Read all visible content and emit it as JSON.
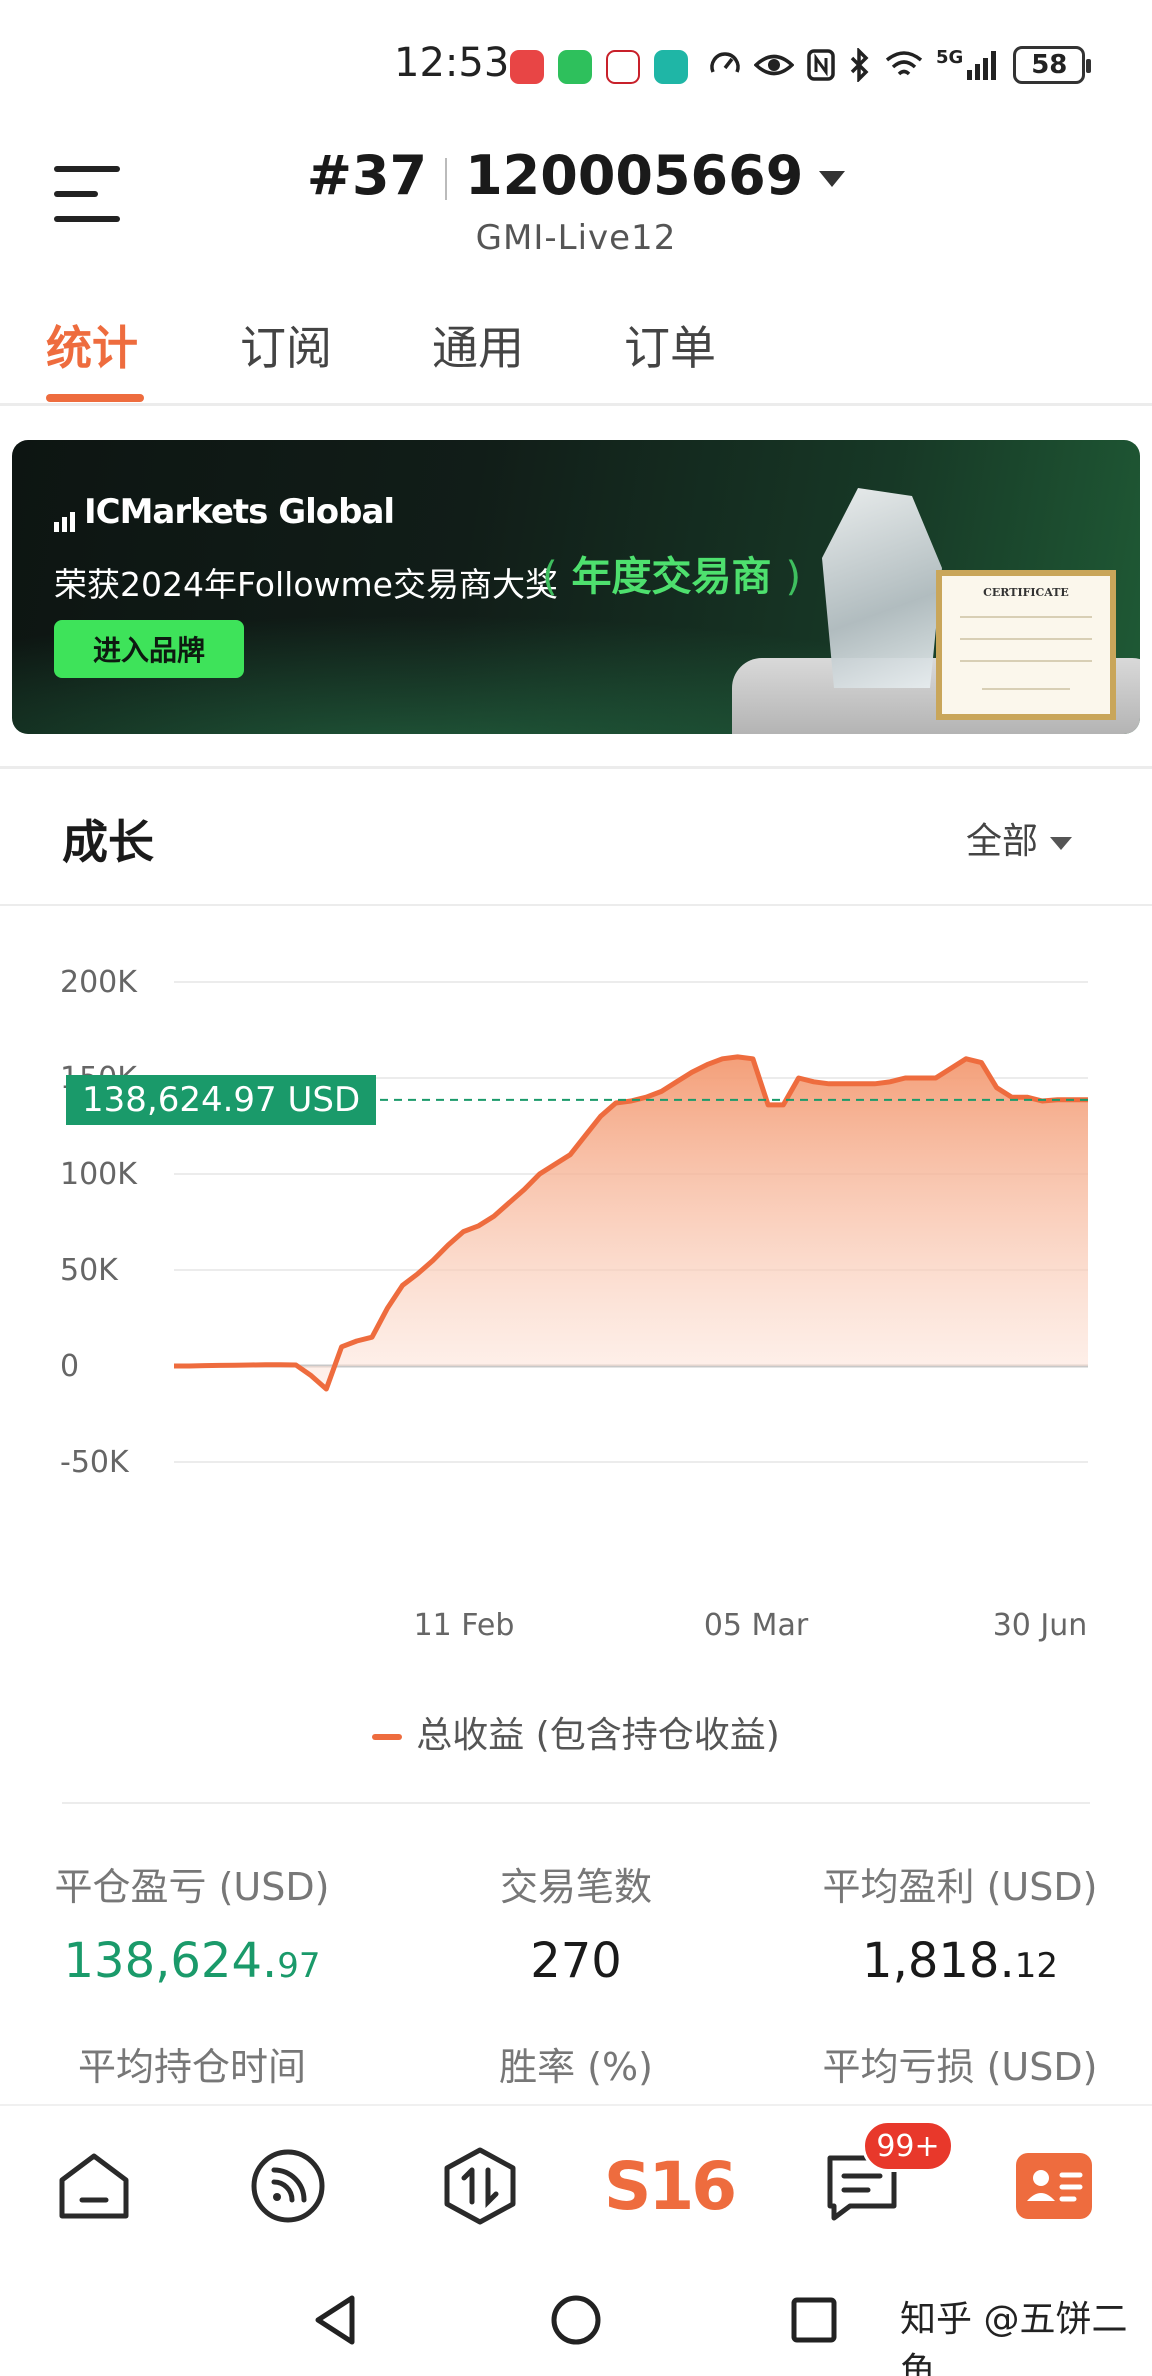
{
  "status_bar": {
    "time": "12:53",
    "network": "5G",
    "battery": "58"
  },
  "header": {
    "account_rank": "#37",
    "account_number": "120005669",
    "server": "GMI-Live12"
  },
  "tabs": [
    {
      "label": "统计",
      "active": true
    },
    {
      "label": "订阅",
      "active": false
    },
    {
      "label": "通用",
      "active": false
    },
    {
      "label": "订单",
      "active": false
    }
  ],
  "banner": {
    "brand": "ICMarkets Global",
    "text": "荣获2024年Followme交易商大奖",
    "award": "年度交易商",
    "button": "进入品牌",
    "certificate_title": "CERTIFICATE"
  },
  "growth": {
    "title": "成长",
    "filter": "全部"
  },
  "chart_data": {
    "type": "area",
    "y_ticks": [
      "200K",
      "150K",
      "100K",
      "50K",
      "0",
      "-50K"
    ],
    "ylim": [
      -50000,
      200000
    ],
    "x_ticks": [
      "11 Feb",
      "05 Mar",
      "30 Jun"
    ],
    "last_value_label": "138,624.97 USD",
    "last_value": 138624.97,
    "series": [
      {
        "name": "总收益 (包含持仓收益)",
        "color": "#ee6c3e",
        "values": [
          0,
          0,
          200,
          300,
          400,
          500,
          600,
          700,
          500,
          -5000,
          -12000,
          10000,
          13000,
          15000,
          30000,
          42000,
          48000,
          55000,
          63000,
          70000,
          73000,
          78000,
          85000,
          92000,
          100000,
          105000,
          110000,
          120000,
          130000,
          137000,
          138000,
          140000,
          143000,
          148000,
          153000,
          157000,
          160000,
          161000,
          160000,
          136000,
          136000,
          150000,
          148000,
          147000,
          147000,
          147000,
          147000,
          148000,
          150000,
          150000,
          150000,
          155000,
          160000,
          158000,
          145000,
          140000,
          140000,
          138000,
          138624.97,
          138624.97,
          138624.97
        ]
      }
    ],
    "grid": true
  },
  "stats": [
    {
      "label": "平仓盈亏 (USD)",
      "value_main": "138,624.",
      "value_small": ".97",
      "color": "#1a9a6a"
    },
    {
      "label": "交易笔数",
      "value_main": "270",
      "value_small": ""
    },
    {
      "label": "平均盈利 (USD)",
      "value_main": "1,818.",
      "value_small": "12"
    },
    {
      "label": "平均持仓时间"
    },
    {
      "label": "胜率 (%)"
    },
    {
      "label": "平均亏损 (USD)"
    }
  ],
  "bottom_nav": {
    "items": [
      "home-icon",
      "feed-icon",
      "trade-icon",
      "s16-logo",
      "messages-icon",
      "profile-icon"
    ],
    "s16": "S16",
    "badge": "99+"
  },
  "watermark": "知乎 @五饼二鱼",
  "colors": {
    "accent": "#ee6c3e",
    "profit": "#1a9a6a"
  }
}
